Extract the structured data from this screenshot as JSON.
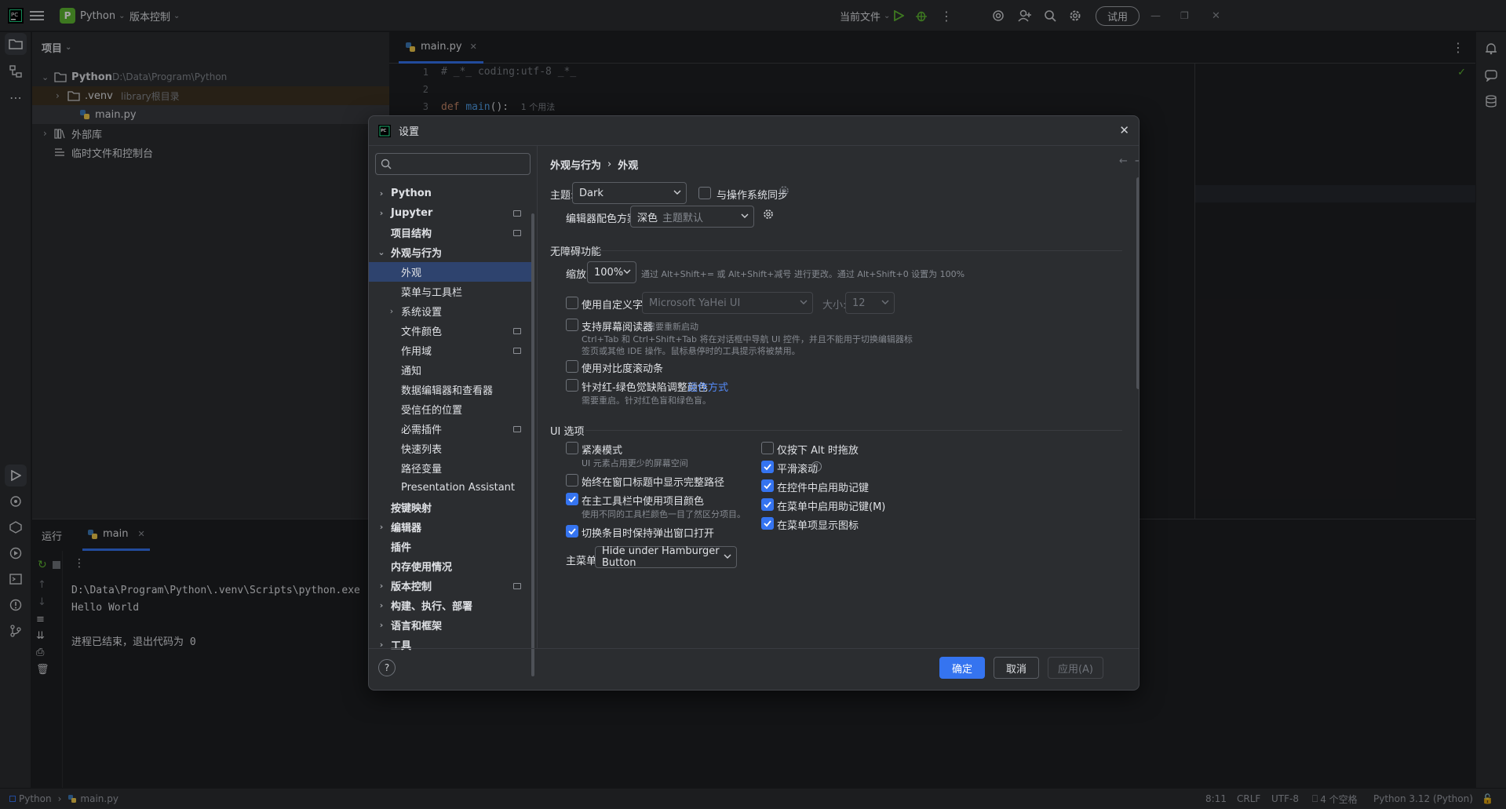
{
  "titlebar": {
    "project_badge": "P",
    "project": "Python",
    "vcs": "版本控制",
    "run_config": "当前文件",
    "trial": "试用"
  },
  "project_panel": {
    "title": "项目",
    "tree": [
      {
        "label": "Python",
        "note": "D:\\Data\\Program\\Python"
      },
      {
        "label": ".venv",
        "note": "library根目录"
      },
      {
        "label": "main.py",
        "note": ""
      },
      {
        "label": "外部库",
        "note": ""
      },
      {
        "label": "临时文件和控制台",
        "note": ""
      }
    ]
  },
  "editor": {
    "tab": "main.py",
    "lines": [
      "1",
      "2",
      "3"
    ],
    "code_line1": "# _*_ coding:utf-8 _*_",
    "code_def": "def ",
    "code_fn": "main",
    "code_rest": "():",
    "code_hint": "1 个用法"
  },
  "run": {
    "tab_label": "运行",
    "config": "main",
    "console": [
      "D:\\Data\\Program\\Python\\.venv\\Scripts\\python.exe",
      "Hello World",
      "",
      "进程已结束，退出代码为 0"
    ]
  },
  "statusbar": {
    "project": "Python",
    "file": "main.py",
    "position": "8:11",
    "line_sep": "CRLF",
    "encoding": "UTF-8",
    "indent": "4 个空格",
    "interpreter": "Python 3.12 (Python)"
  },
  "settings": {
    "title": "设置",
    "nav": [
      {
        "label": "Python",
        "level": 0,
        "arrow": "›",
        "bold": true
      },
      {
        "label": "Jupyter",
        "level": 0,
        "arrow": "›",
        "bold": true,
        "mark": true
      },
      {
        "label": "项目结构",
        "level": 0,
        "arrow": "",
        "bold": true,
        "mark": true
      },
      {
        "label": "外观与行为",
        "level": 0,
        "arrow": "⌄",
        "bold": true
      },
      {
        "label": "外观",
        "level": 1,
        "arrow": "",
        "selected": true
      },
      {
        "label": "菜单与工具栏",
        "level": 1,
        "arrow": ""
      },
      {
        "label": "系统设置",
        "level": 1,
        "arrow": "›"
      },
      {
        "label": "文件颜色",
        "level": 1,
        "arrow": "",
        "mark": true
      },
      {
        "label": "作用域",
        "level": 1,
        "arrow": "",
        "mark": true
      },
      {
        "label": "通知",
        "level": 1,
        "arrow": ""
      },
      {
        "label": "数据编辑器和查看器",
        "level": 1,
        "arrow": ""
      },
      {
        "label": "受信任的位置",
        "level": 1,
        "arrow": ""
      },
      {
        "label": "必需插件",
        "level": 1,
        "arrow": "",
        "mark": true
      },
      {
        "label": "快速列表",
        "level": 1,
        "arrow": ""
      },
      {
        "label": "路径变量",
        "level": 1,
        "arrow": ""
      },
      {
        "label": "Presentation Assistant",
        "level": 1,
        "arrow": ""
      },
      {
        "label": "按键映射",
        "level": 0,
        "arrow": "",
        "bold": true
      },
      {
        "label": "编辑器",
        "level": 0,
        "arrow": "›",
        "bold": true
      },
      {
        "label": "插件",
        "level": 0,
        "arrow": "",
        "bold": true
      },
      {
        "label": "内存使用情况",
        "level": 0,
        "arrow": "",
        "bold": true
      },
      {
        "label": "版本控制",
        "level": 0,
        "arrow": "›",
        "bold": true,
        "mark": true
      },
      {
        "label": "构建、执行、部署",
        "level": 0,
        "arrow": "›",
        "bold": true
      },
      {
        "label": "语言和框架",
        "level": 0,
        "arrow": "›",
        "bold": true
      },
      {
        "label": "工具",
        "level": 0,
        "arrow": "›",
        "bold": true
      }
    ],
    "breadcrumb": [
      "外观与行为",
      "外观"
    ],
    "theme_label": "主题:",
    "theme_value": "Dark",
    "sync_os": "与操作系统同步",
    "scheme_label": "编辑器配色方案:",
    "scheme_value": "深色",
    "scheme_hint": "主题默认",
    "accessibility": "无障碍功能",
    "zoom_label": "缩放:",
    "zoom_value": "100%",
    "zoom_hint": "通过 Alt+Shift+= 或 Alt+Shift+减号 进行更改。通过 Alt+Shift+0 设置为 100%",
    "custom_font": "使用自定义字体:",
    "font_value": "Microsoft YaHei UI",
    "size_label": "大小:",
    "size_value": "12",
    "screen_reader": "支持屏幕阅读器",
    "screen_reader_hint": "需要重新启动",
    "screen_reader_desc1": "Ctrl+Tab 和 Ctrl+Shift+Tab 将在对话框中导航 UI 控件，并且不能用于切换编辑器标",
    "screen_reader_desc2": "签页或其他 IDE 操作。鼠标悬停时的工具提示将被禁用。",
    "contrast_scroll": "使用对比度滚动条",
    "color_blind": "针对红-绿色觉缺陷调整颜色",
    "color_blind_link": "运作方式",
    "color_blind_hint": "需要重启。针对红色盲和绿色盲。",
    "ui_options": "UI 选项",
    "compact": "紧凑模式",
    "compact_hint": "UI 元素占用更少的屏幕空间",
    "full_path": "始终在窗口标题中显示完整路径",
    "project_colors": "在主工具栏中使用项目颜色",
    "project_colors_hint": "使用不同的工具栏颜色一目了然区分项目。",
    "keep_popup": "切换条目时保持弹出窗口打开",
    "alt_drag": "仅按下 Alt 时拖放",
    "smooth_scroll": "平滑滚动",
    "mnemonic_controls": "在控件中启用助记键",
    "mnemonic_menus": "在菜单中启用助记键(M)",
    "menu_icons": "在菜单项显示图标",
    "main_menu_label": "主菜单:",
    "main_menu_value": "Hide under Hamburger Button",
    "ok": "确定",
    "cancel": "取消",
    "apply": "应用(A)",
    "help": "?"
  },
  "colors": {
    "accent": "#3574f0",
    "run_green": "#5fb832",
    "debug_green": "#5fb832"
  }
}
